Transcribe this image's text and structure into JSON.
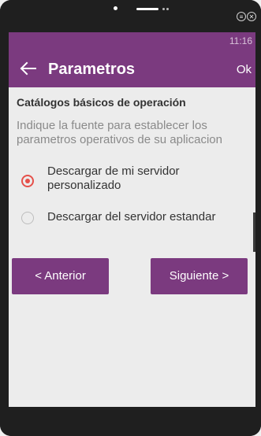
{
  "status_bar": {
    "time": "11:16"
  },
  "app_bar": {
    "title": "Parametros",
    "back_icon": "arrow-left-icon",
    "ok_label": "Ok"
  },
  "content": {
    "section_title": "Catálogos básicos de operación",
    "description": "Indique la fuente para establecer los parametros operativos de su aplicacion",
    "options": [
      {
        "label": "Descargar de mi servidor personalizado",
        "selected": true
      },
      {
        "label": "Descargar del servidor estandar",
        "selected": false
      }
    ]
  },
  "buttons": {
    "previous": "< Anterior",
    "next": "Siguiente >"
  },
  "colors": {
    "primary": "#7b3a7f",
    "accent": "#e5504a",
    "background": "#ececec"
  },
  "device": {
    "menu_icon": "menu-icon",
    "close_icon": "close-icon",
    "menu_glyph": "≡",
    "close_glyph": "✕"
  }
}
